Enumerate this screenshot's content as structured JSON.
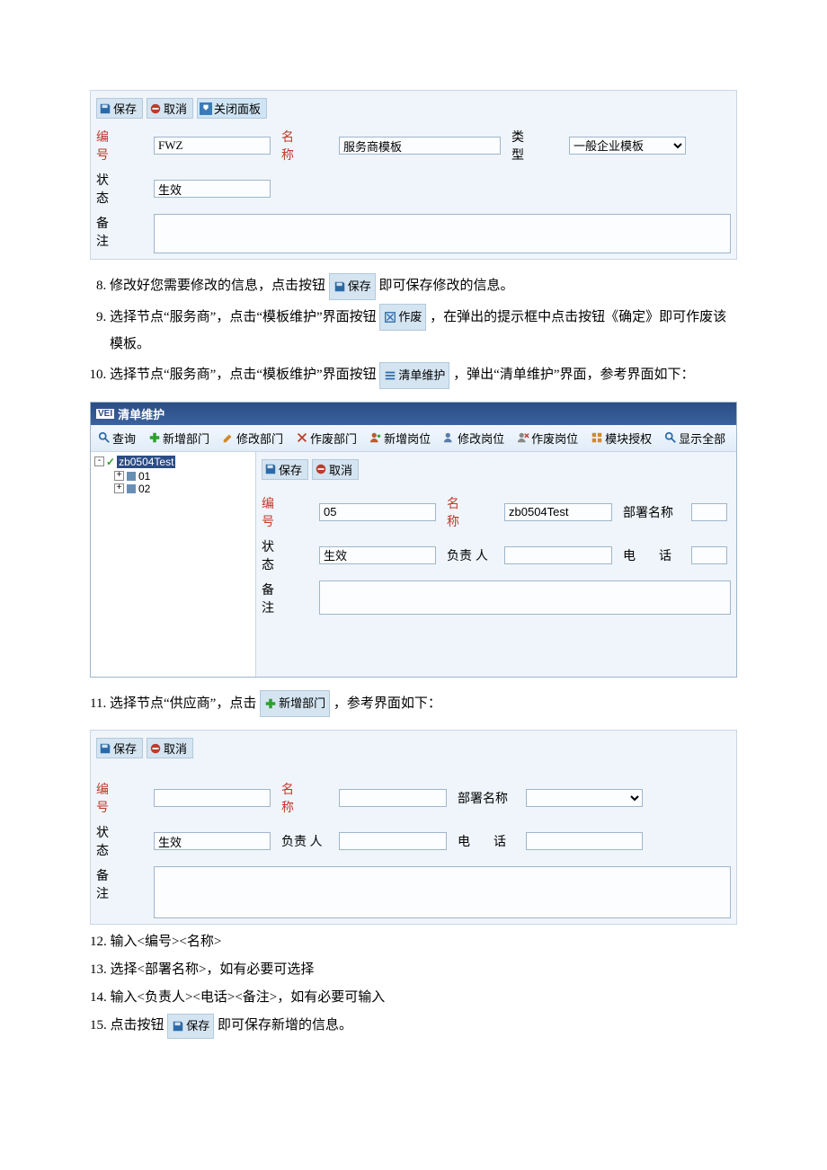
{
  "panel1": {
    "save": "保存",
    "cancel": "取消",
    "close": "关闭面板",
    "lbl_id": "编　号",
    "lbl_name": "名　称",
    "lbl_type": "类　型",
    "lbl_state": "状　态",
    "lbl_remark": "备　注",
    "val_id": "FWZ",
    "val_name": "服务商模板",
    "val_type": "一般企业模板",
    "val_state": "生效",
    "val_remark": ""
  },
  "instr": {
    "i8_a": "修改好您需要修改的信息，点击按钮",
    "i8_b": "即可保存修改的信息。",
    "i9_a": "选择节点“服务商”，点击“模板维护”界面按钮",
    "i9_b": "，在弹出的提示框中点击按钮《确定》即可作废该模板。",
    "i10_a": "选择节点“服务商”，点击“模板维护”界面按钮",
    "i10_b": "，弹出“清单维护”界面，参考界面如下：",
    "i11_a": "选择节点“供应商”，点击",
    "i11_b": "，参考界面如下：",
    "i12": "输入<编号><名称>",
    "i13": "选择<部署名称>，如有必要可选择",
    "i14": "输入<负责人><电话><备注>，如有必要可输入",
    "i15_a": "点击按钮",
    "i15_b": "即可保存新增的信息。",
    "btn_save": "保存",
    "btn_void": "作废",
    "btn_listmaint": "清单维护",
    "btn_adddept": "新增部门"
  },
  "window": {
    "title": "清单维护",
    "tb": {
      "query": "查询",
      "adddept": "新增部门",
      "moddept": "修改部门",
      "voiddept": "作废部门",
      "addpost": "新增岗位",
      "modpost": "修改岗位",
      "voidpost": "作废岗位",
      "moduleauth": "模块授权",
      "showall": "显示全部"
    },
    "tree": {
      "root": "zb0504Test",
      "c1": "01",
      "c2": "02"
    },
    "detail": {
      "save": "保存",
      "cancel": "取消",
      "lbl_id": "编　号",
      "lbl_name": "名　称",
      "lbl_deploy": "部署名称",
      "lbl_state": "状　态",
      "lbl_owner": "负责 人",
      "lbl_phone": "电　话",
      "lbl_remark": "备　注",
      "val_id": "05",
      "val_name": "zb0504Test",
      "val_state": "生效"
    }
  },
  "panel3": {
    "save": "保存",
    "cancel": "取消",
    "lbl_id": "编　号",
    "lbl_name": "名　称",
    "lbl_deploy": "部署名称",
    "lbl_state": "状　态",
    "lbl_owner": "负责 人",
    "lbl_phone": "电　话",
    "lbl_remark": "备　注",
    "val_state": "生效"
  }
}
